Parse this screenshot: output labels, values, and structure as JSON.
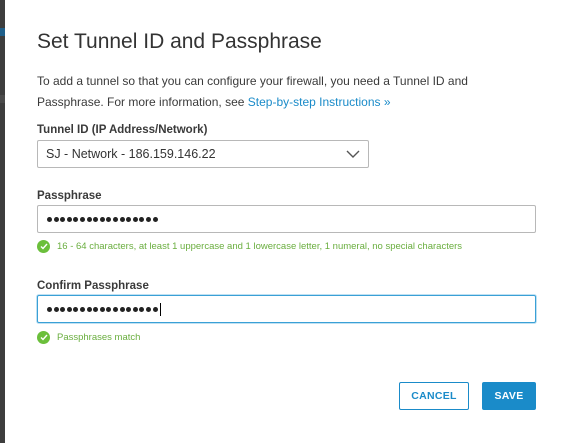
{
  "dialog": {
    "title": "Set Tunnel ID and Passphrase",
    "description_line1": "To add a tunnel so that you can configure your firewall, you need a Tunnel ID and",
    "description_line2_prefix": "Passphrase. For more information, see ",
    "instructions_link": "Step-by-step Instructions »"
  },
  "tunnel_id": {
    "label": "Tunnel ID (IP Address/Network)",
    "selected_value": "SJ - Network - 186.159.146.22",
    "icon": "chevron-down-icon"
  },
  "passphrase": {
    "label": "Passphrase",
    "masked_length": 17,
    "hint": "16 - 64 characters, at least 1 uppercase and 1 lowercase letter, 1 numeral, no special characters",
    "hint_icon": "check-circle-icon"
  },
  "confirm_passphrase": {
    "label": "Confirm Passphrase",
    "masked_length": 17,
    "hint": "Passphrases match",
    "hint_icon": "check-circle-icon"
  },
  "buttons": {
    "cancel": "CANCEL",
    "save": "SAVE"
  },
  "colors": {
    "accent": "#1a8bc9",
    "success": "#6bbf3b",
    "text": "#333333"
  }
}
